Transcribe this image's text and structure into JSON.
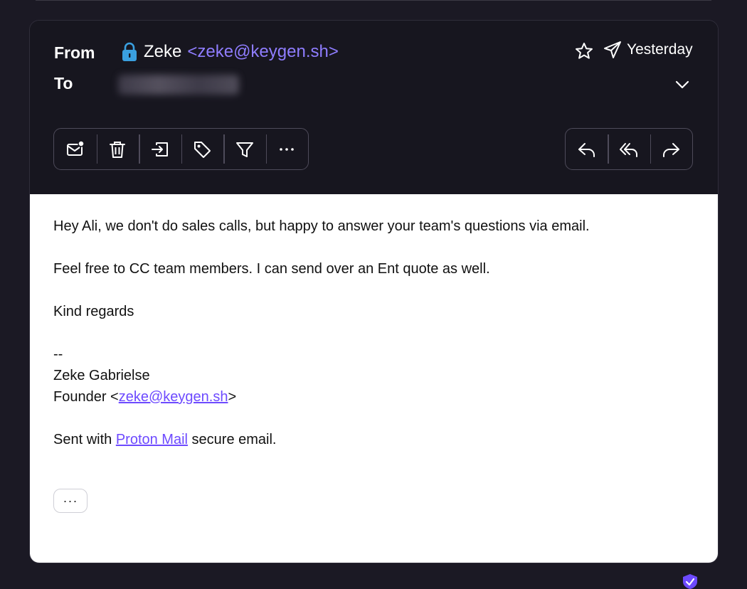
{
  "header": {
    "from_label": "From",
    "to_label": "To",
    "sender_name": "Zeke",
    "sender_email": "<zeke@keygen.sh>",
    "date": "Yesterday",
    "icons": {
      "lock": "lock-icon",
      "star": "star-icon",
      "sent": "paper-plane-icon",
      "expand": "chevron-down-icon"
    }
  },
  "toolbar": {
    "left": [
      {
        "name": "mark-unread-button",
        "icon": "envelope-unread-icon"
      },
      {
        "name": "trash-button",
        "icon": "trash-icon"
      },
      {
        "name": "move-button",
        "icon": "move-to-folder-icon"
      },
      {
        "name": "label-button",
        "icon": "tag-icon"
      },
      {
        "name": "filter-button",
        "icon": "filter-icon"
      },
      {
        "name": "more-actions-button",
        "icon": "more-horizontal-icon"
      }
    ],
    "right": [
      {
        "name": "reply-button",
        "icon": "reply-icon"
      },
      {
        "name": "reply-all-button",
        "icon": "reply-all-icon"
      },
      {
        "name": "forward-button",
        "icon": "forward-icon"
      }
    ]
  },
  "body": {
    "line1": "Hey Ali, we don't do sales calls, but happy to answer your team's questions via email.",
    "line2": "Feel free to CC team members. I can send over an Ent quote as well.",
    "line3": "Kind regards",
    "sig_dash": "--",
    "sig_name": "Zeke Gabrielse",
    "sig_title_prefix": "Founder <",
    "sig_email": "zeke@keygen.sh",
    "sig_title_suffix": ">",
    "sent_prefix": "Sent with ",
    "sent_link": "Proton Mail",
    "sent_suffix": " secure email.",
    "show_more": "···"
  },
  "colors": {
    "background": "#1b1924",
    "accent": "#8f7dff",
    "link": "#6d4aff",
    "lock": "#3aa0e0"
  }
}
